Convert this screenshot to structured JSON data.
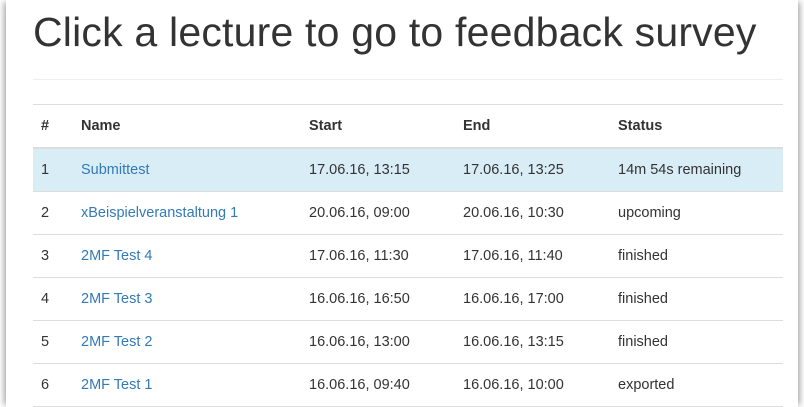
{
  "page": {
    "title": "Click a lecture to go to feedback survey"
  },
  "table": {
    "headers": {
      "index": "#",
      "name": "Name",
      "start": "Start",
      "end": "End",
      "status": "Status"
    },
    "rows": [
      {
        "index": "1",
        "name": "Submittest",
        "start": "17.06.16, 13:15",
        "end": "17.06.16, 13:25",
        "status": "14m 54s remaining",
        "highlighted": true
      },
      {
        "index": "2",
        "name": "xBeispielveranstaltung 1",
        "start": "20.06.16, 09:00",
        "end": "20.06.16, 10:30",
        "status": "upcoming"
      },
      {
        "index": "3",
        "name": "2MF Test 4",
        "start": "17.06.16, 11:30",
        "end": "17.06.16, 11:40",
        "status": "finished"
      },
      {
        "index": "4",
        "name": "2MF Test 3",
        "start": "16.06.16, 16:50",
        "end": "16.06.16, 17:00",
        "status": "finished"
      },
      {
        "index": "5",
        "name": "2MF Test 2",
        "start": "16.06.16, 13:00",
        "end": "16.06.16, 13:15",
        "status": "finished"
      },
      {
        "index": "6",
        "name": "2MF Test 1",
        "start": "16.06.16, 09:40",
        "end": "16.06.16, 10:00",
        "status": "exported"
      }
    ]
  },
  "colors": {
    "link": "#337ab7",
    "active_row": "#d9edf7",
    "text": "#333333"
  }
}
